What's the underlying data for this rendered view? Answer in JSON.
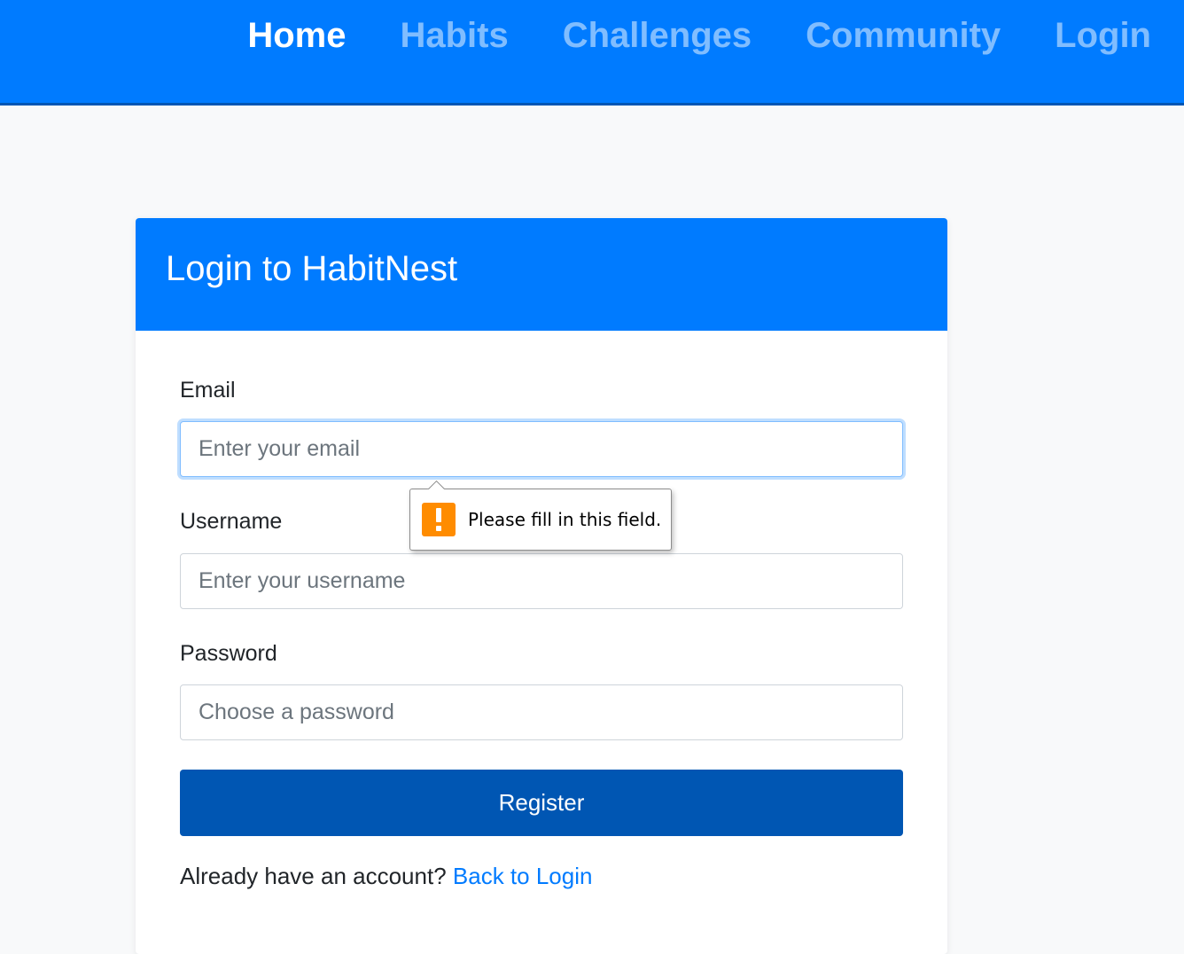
{
  "nav": {
    "items": [
      {
        "label": "Home",
        "active": true
      },
      {
        "label": "Habits",
        "active": false
      },
      {
        "label": "Challenges",
        "active": false
      },
      {
        "label": "Community",
        "active": false
      },
      {
        "label": "Login",
        "active": false
      }
    ]
  },
  "card": {
    "title": "Login to HabitNest",
    "fields": {
      "email": {
        "label": "Email",
        "placeholder": "Enter your email",
        "value": ""
      },
      "username": {
        "label": "Username",
        "placeholder": "Enter your username",
        "value": ""
      },
      "password": {
        "label": "Password",
        "placeholder": "Choose a password",
        "value": ""
      }
    },
    "submit_label": "Register",
    "footer": {
      "prompt": "Already have an account?",
      "link_label": "Back to Login"
    }
  },
  "validation_tooltip": {
    "icon": "warning-icon",
    "message": "Please fill in this field."
  },
  "colors": {
    "primary": "#007bff",
    "primary_dark": "#0056b3",
    "warning": "#ff8c00",
    "background": "#f8f9fa"
  }
}
